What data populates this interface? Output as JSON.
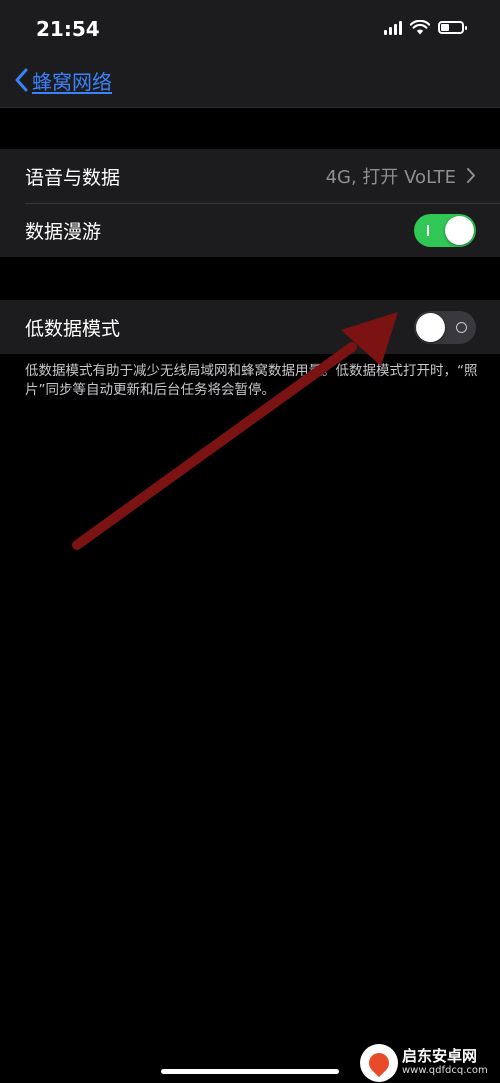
{
  "status_bar": {
    "time": "21:54",
    "icons": [
      "signal-icon",
      "wifi-icon",
      "battery-icon"
    ]
  },
  "nav": {
    "back_label": "蜂窝网络",
    "back_icon": "chevron-left-icon"
  },
  "rows": {
    "voice_data": {
      "label": "语音与数据",
      "value": "4G, 打开 VoLTE",
      "icon": "chevron-right-icon"
    },
    "data_roaming": {
      "label": "数据漫游",
      "toggle": "on"
    },
    "low_data_mode": {
      "label": "低数据模式",
      "toggle": "off"
    }
  },
  "low_data_footer": "低数据模式有助于减少无线局域网和蜂窝数据用量。低数据模式打开时，“照片”同步等自动更新和后台任务将会暂停。",
  "annotation": {
    "color": "#7b1312",
    "points_to": "low-data-mode-toggle"
  },
  "watermark": {
    "name": "启东安卓网",
    "url": "www.qdfdcq.com"
  },
  "colors": {
    "accent": "#3a82f7",
    "toggle_on": "#30c755",
    "toggle_off": "#39393d",
    "group_background": "#1c1c1e",
    "page_background": "#000000"
  }
}
